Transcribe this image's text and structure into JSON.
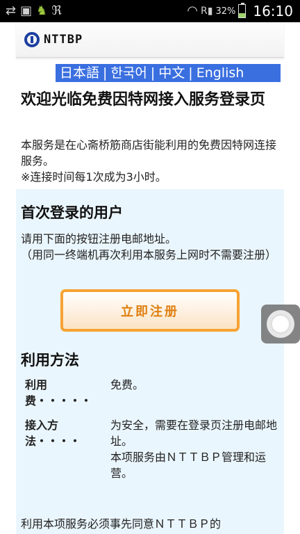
{
  "status_bar": {
    "battery_percent": "32%",
    "time": "16:10",
    "icons": [
      "usb-icon",
      "image-icon",
      "android-icon",
      "app-icon",
      "wifi-icon",
      "signal-icon",
      "battery-icon"
    ]
  },
  "header": {
    "logo_text": "NTTBP"
  },
  "language_bar": {
    "items": [
      "日本語",
      "한국어",
      "中文",
      "English"
    ],
    "separator": "|"
  },
  "welcome": {
    "title": "欢迎光临免费因特网接入服务登录页",
    "lines": [
      "本服务是在心斋桥筋商店街能利用的免费因特网连接服务。",
      "※连接时间每1次成为3小时。"
    ]
  },
  "first_login": {
    "heading": "首次登录的用户",
    "lines": [
      "请用下面的按钮注册电邮地址。",
      "（用同一终端机再次利用本服务上网时不需要注册）"
    ],
    "register_button": "立即注册"
  },
  "usage": {
    "heading": "利用方法",
    "rows": [
      {
        "key": "利用费・・・・・",
        "value": [
          "免费。"
        ]
      },
      {
        "key": "接入方法・・・・",
        "value": [
          "为安全，需要在登录页注册电邮地址。",
          "本项服务由ＮＴＴＢＰ管理和运营。"
        ]
      }
    ]
  },
  "footer_text": "利用本项服务必须事先同意ＮＴＴＢＰ的",
  "colors": {
    "lang_bar": "#3a6fe0",
    "info_bg": "#eaf6fd",
    "button_border": "#f6a334",
    "button_text": "#e07f10"
  }
}
